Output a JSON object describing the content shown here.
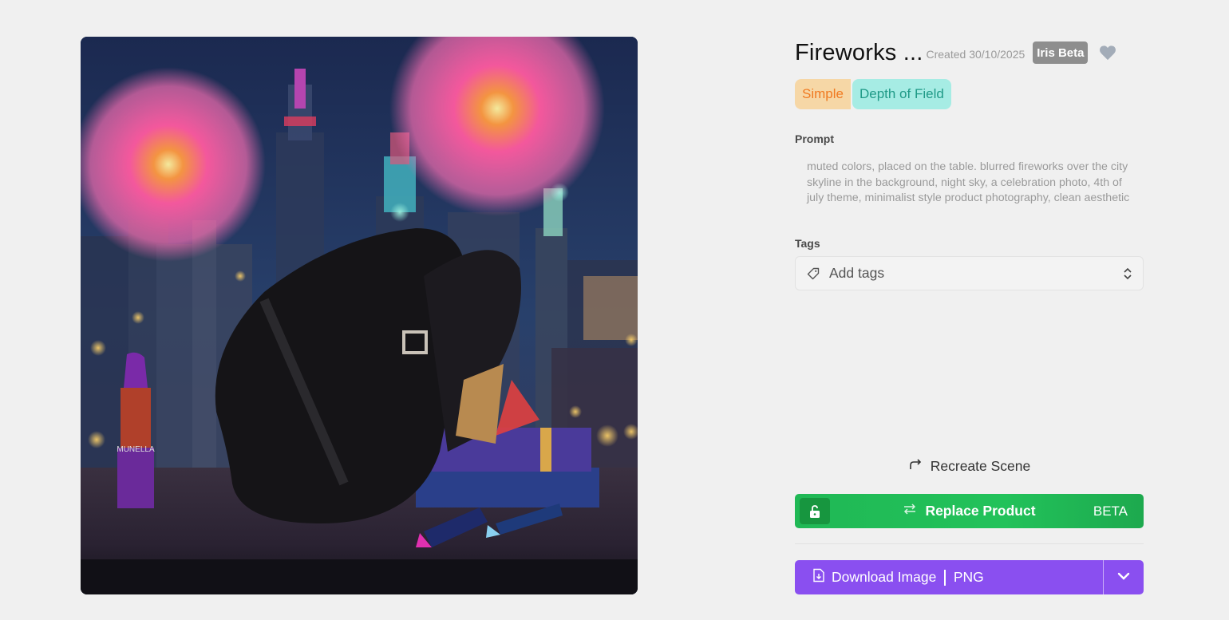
{
  "image": {
    "alt": "Generated product photo",
    "lipstick_brand": "MUNELLA"
  },
  "header": {
    "title": "Fireworks ...",
    "created": "Created 30/10/2025",
    "badge": "Iris Beta",
    "heart_icon": "heart-icon"
  },
  "style_chips": [
    "Simple",
    "Depth of Field"
  ],
  "prompt": {
    "label": "Prompt",
    "text": "muted colors, placed on the table. blurred fireworks over the city skyline in the background, night sky, a celebration photo, 4th of july theme, minimalist style product photography, clean aesthetic"
  },
  "tags": {
    "label": "Tags",
    "placeholder": "Add tags"
  },
  "actions": {
    "recreate_label": "Recreate Scene",
    "replace_label": "Replace Product",
    "replace_badge": "BETA",
    "download_label": "Download Image",
    "download_format": "PNG"
  },
  "colors": {
    "background": "#f0f0f0",
    "replace_green": "#22c25a",
    "download_purple": "#8a4ff0",
    "chip_simple_bg": "#f6d7a6",
    "chip_simple_fg": "#f07a21",
    "chip_dof_bg": "#a6ece4",
    "chip_dof_fg": "#1f9a87",
    "badge_gray": "#8e8e8e"
  }
}
